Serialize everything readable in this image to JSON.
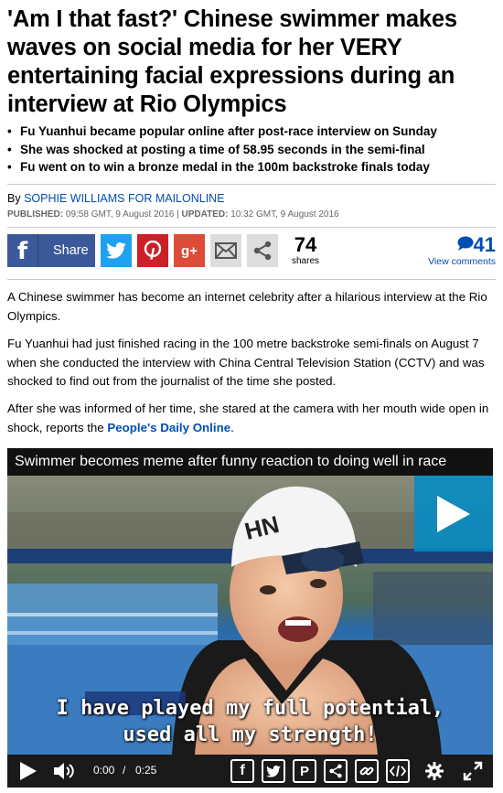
{
  "article": {
    "headline": "'Am I that fast?' Chinese swimmer makes waves on social media for her VERY entertaining facial expressions during an interview at Rio Olympics",
    "bullets": [
      "Fu Yuanhui became popular online after post-race interview on Sunday",
      "She was shocked at posting a time of 58.95 seconds in the semi-final",
      "Fu went on to win a bronze medal in the 100m backstroke finals today"
    ],
    "byline_prefix": "By ",
    "author": "SOPHIE WILLIAMS FOR MAILONLINE",
    "published_label": "PUBLISHED:",
    "published_value": " 09:58 GMT, 9 August 2016 | ",
    "updated_label": "UPDATED:",
    "updated_value": " 10:32 GMT, 9 August 2016",
    "paragraphs": [
      "A Chinese swimmer has become an internet celebrity after a hilarious interview at the Rio Olympics.",
      "Fu Yuanhui had just finished racing in the 100 metre backstroke semi-finals on August 7 when she conducted the interview with China Central Television Station (CCTV) and was shocked to find out from the journalist of the time she posted."
    ],
    "para3_text": "After she was informed of her time, she stared at the camera with her mouth wide open in shock, reports the ",
    "para3_link": "People's Daily Online",
    "para3_end": "."
  },
  "share": {
    "facebook_label": "Share",
    "google_plus_label": "g+",
    "share_count": "74",
    "share_count_label": "shares",
    "comment_count": "41",
    "comments_label": "View comments",
    "icons": [
      "facebook-icon",
      "twitter-icon",
      "pinterest-icon",
      "google-plus-icon",
      "email-icon",
      "share-icon"
    ],
    "colors": {
      "facebook": "#3b5998",
      "twitter": "#1da1f2",
      "pinterest": "#cb2027",
      "google_plus": "#dd4b39",
      "link": "#004db3"
    }
  },
  "video": {
    "title": "Swimmer becomes meme after funny reaction to doing well in race",
    "subtitle_line1": "I have played my full potential,",
    "subtitle_line2": "used all my strength!",
    "current_time": "0:00",
    "time_separator": "/",
    "duration": "0:25",
    "control_icons": [
      "play-icon",
      "volume-icon",
      "facebook-icon",
      "twitter-icon",
      "pinterest-icon",
      "share-icon",
      "link-icon",
      "embed-icon",
      "settings-icon",
      "fullscreen-icon"
    ]
  }
}
